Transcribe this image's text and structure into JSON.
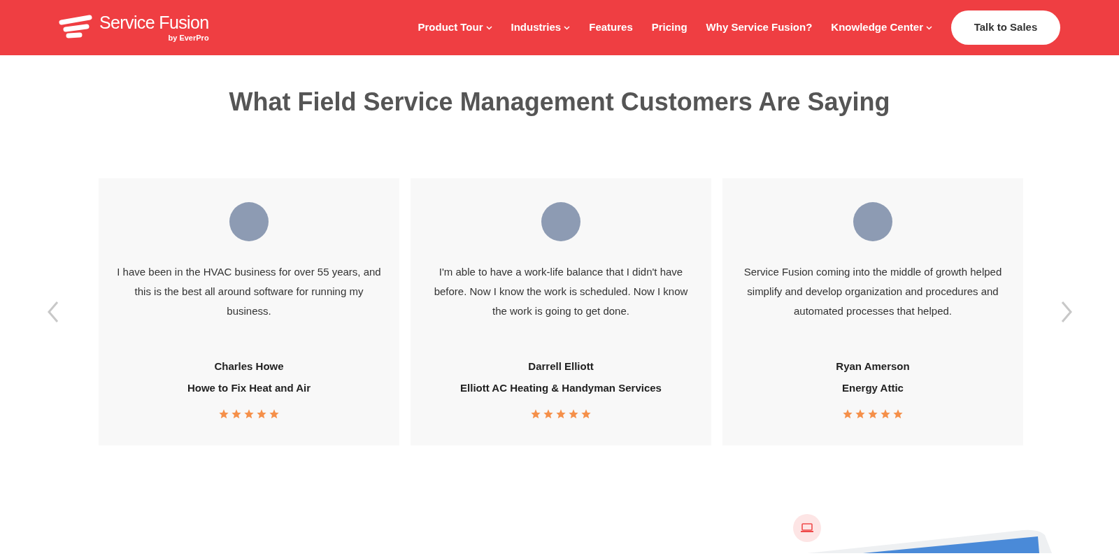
{
  "header": {
    "logo": {
      "name": "Service Fusion",
      "byline": "by EverPro"
    },
    "nav": [
      {
        "label": "Product Tour",
        "dropdown": true
      },
      {
        "label": "Industries",
        "dropdown": true
      },
      {
        "label": "Features",
        "dropdown": false
      },
      {
        "label": "Pricing",
        "dropdown": false
      },
      {
        "label": "Why Service Fusion?",
        "dropdown": false
      },
      {
        "label": "Knowledge Center",
        "dropdown": true
      }
    ],
    "cta": "Talk to Sales"
  },
  "heading": "What Field Service Management Customers Are Saying",
  "testimonials": [
    {
      "quote": "I have been in the HVAC business for over 55 years, and this is the best all around software for running my business.",
      "name": "Charles Howe",
      "company": "Howe to Fix Heat and Air",
      "stars": 5
    },
    {
      "quote": "I'm able to have a work-life balance that I didn't have before. Now I know the work is scheduled. Now I know the work is going to get done.",
      "name": "Darrell Elliott",
      "company": "Elliott AC Heating & Handyman Services",
      "stars": 5
    },
    {
      "quote": "Service Fusion coming into the middle of growth helped simplify and develop organization and procedures and automated processes that helped.",
      "name": "Ryan Amerson",
      "company": "Energy Attic",
      "stars": 5
    }
  ]
}
